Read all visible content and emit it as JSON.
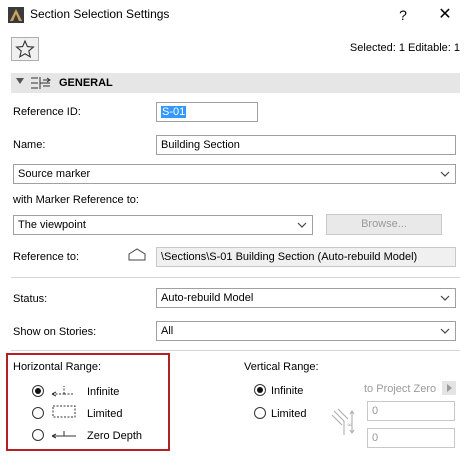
{
  "window": {
    "title": "Section Selection Settings",
    "help": "?",
    "close": "✕"
  },
  "header": {
    "selected_info": "Selected: 1 Editable: 1"
  },
  "section": {
    "title": "GENERAL"
  },
  "fields": {
    "reference_id_label": "Reference ID:",
    "reference_id_value": "S-01",
    "name_label": "Name:",
    "name_value": "Building Section",
    "marker_type": "Source marker",
    "marker_ref_label": "with Marker Reference to:",
    "marker_ref_value": "The viewpoint",
    "browse_label": "Browse...",
    "reference_to_label": "Reference to:",
    "reference_to_value": "\\Sections\\S-01 Building Section (Auto-rebuild Model)",
    "status_label": "Status:",
    "status_value": "Auto-rebuild Model",
    "stories_label": "Show on Stories:",
    "stories_value": "All"
  },
  "horizontal_range": {
    "title": "Horizontal Range:",
    "options": [
      {
        "label": "Infinite",
        "selected": true
      },
      {
        "label": "Limited",
        "selected": false
      },
      {
        "label": "Zero Depth",
        "selected": false
      }
    ]
  },
  "vertical_range": {
    "title": "Vertical Range:",
    "options": [
      {
        "label": "Infinite",
        "selected": true
      },
      {
        "label": "Limited",
        "selected": false
      }
    ],
    "to_project_zero": "to Project Zero",
    "top_value": "0",
    "bottom_value": "0"
  },
  "colors": {
    "highlight": "#b21f24",
    "selection": "#3399ff"
  }
}
